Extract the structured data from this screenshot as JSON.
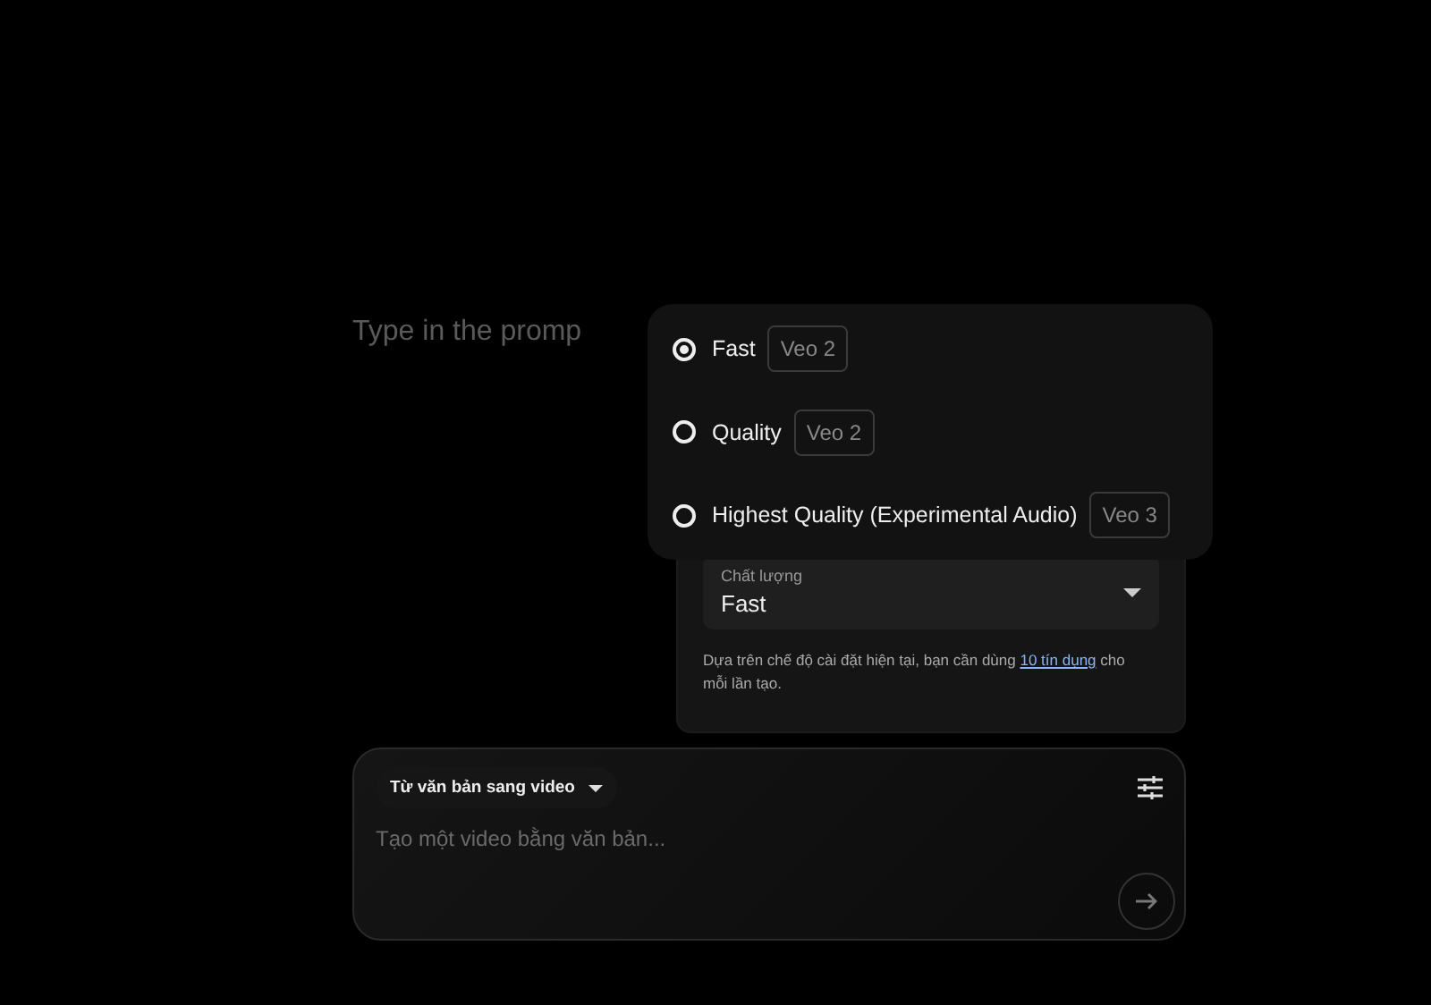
{
  "prompt_hint": "Type in the promp",
  "quality_menu": {
    "options": [
      {
        "label": "Fast",
        "model": "Veo 2",
        "selected": true
      },
      {
        "label": "Quality",
        "model": "Veo 2",
        "selected": false
      },
      {
        "label": "Highest Quality (Experimental Audio)",
        "model": "Veo 3",
        "selected": false
      }
    ]
  },
  "settings": {
    "quality_label": "Chất lượng",
    "quality_value": "Fast",
    "note_before": "Dựa trên chế độ cài đặt hiện tại, bạn cần dùng ",
    "note_link": "10 tín dụng",
    "note_after": " cho mỗi lần tạo."
  },
  "composer": {
    "mode": "Từ văn bản sang video",
    "placeholder": "Tạo một video bằng văn bản..."
  }
}
